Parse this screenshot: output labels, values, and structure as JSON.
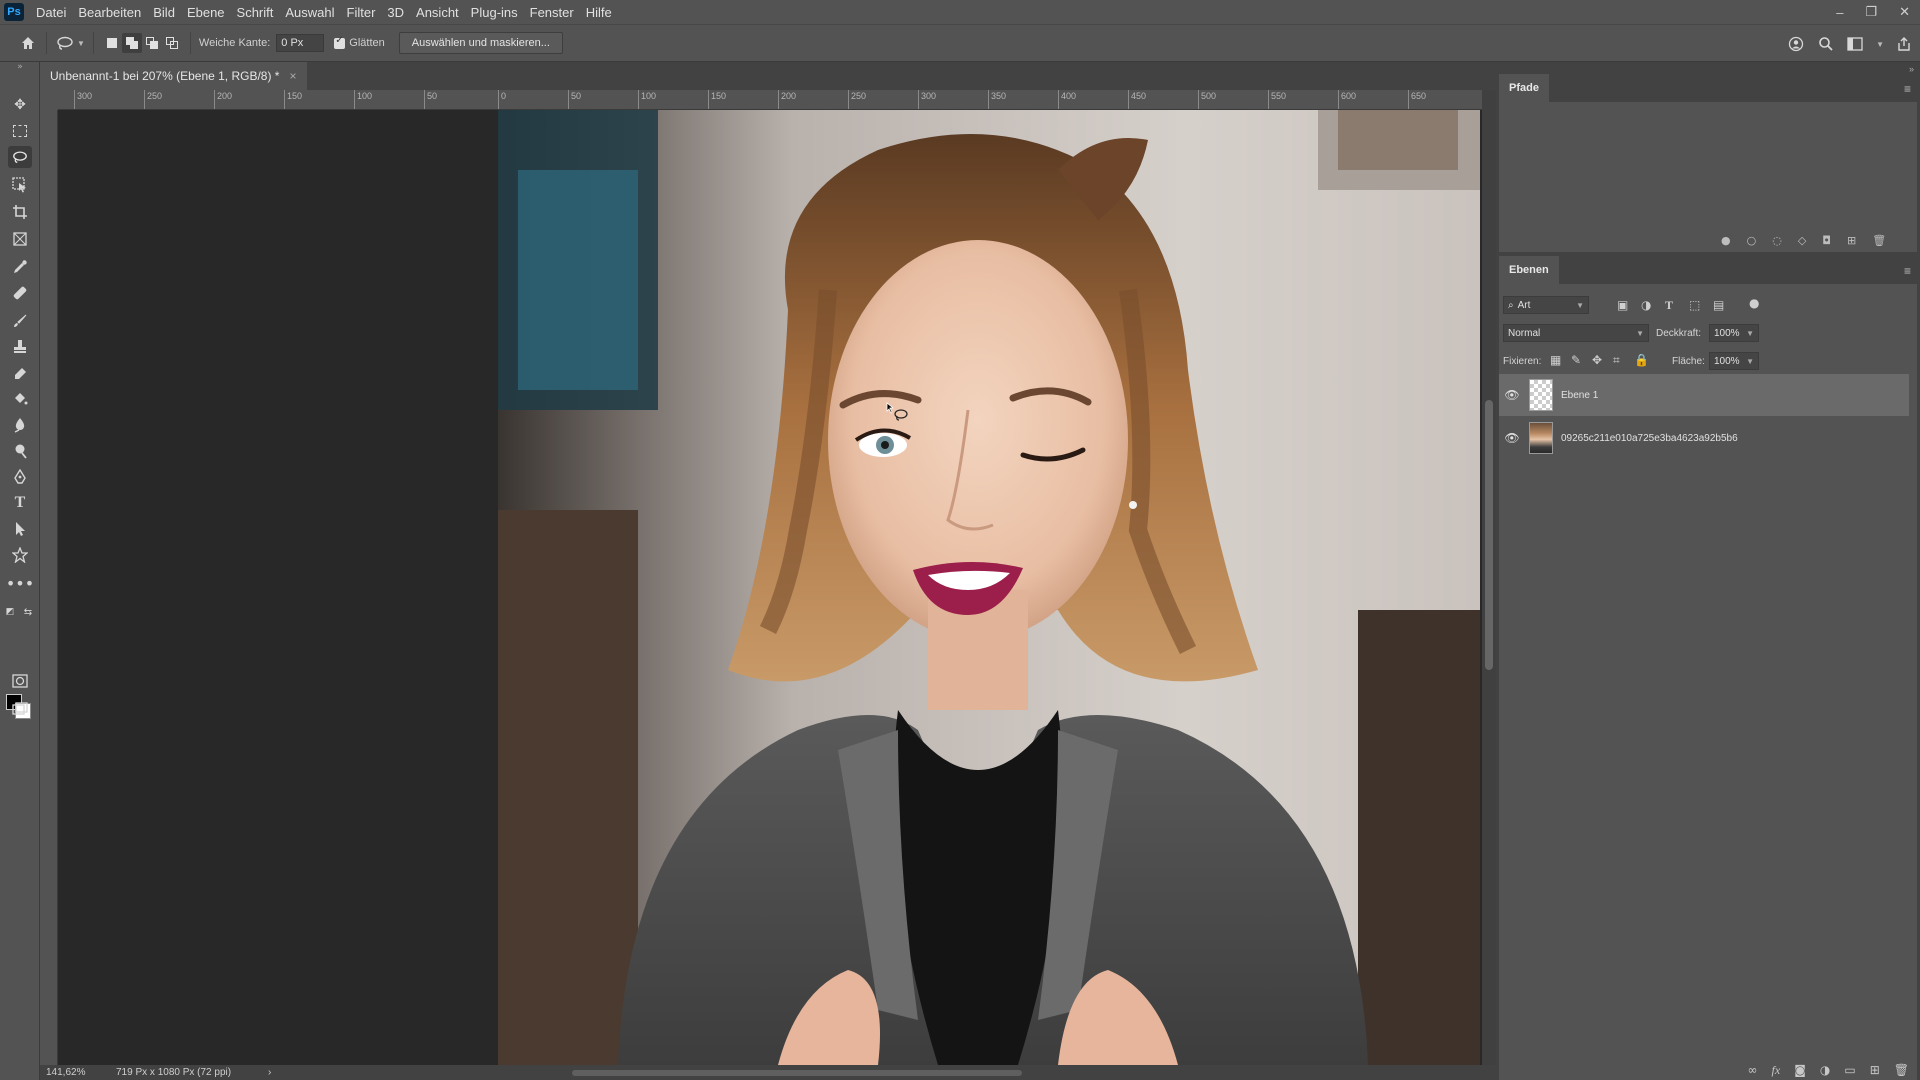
{
  "app": {
    "logo": "Ps"
  },
  "menu": [
    "Datei",
    "Bearbeiten",
    "Bild",
    "Ebene",
    "Schrift",
    "Auswahl",
    "Filter",
    "3D",
    "Ansicht",
    "Plug-ins",
    "Fenster",
    "Hilfe"
  ],
  "window_controls": {
    "minimize": "–",
    "restore": "❐",
    "close": "✕"
  },
  "options": {
    "feather_label": "Weiche Kante:",
    "feather_value": "0 Px",
    "antialias_label": "Glätten",
    "antialias_checked": true,
    "select_mask_button": "Auswählen und maskieren..."
  },
  "document": {
    "tab_title": "Unbenannt-1 bei 207% (Ebene 1, RGB/8) *",
    "tab_close": "×"
  },
  "ruler_top_labels": [
    "300",
    "250",
    "200",
    "150",
    "100",
    "50",
    "0",
    "50",
    "100",
    "150",
    "200",
    "250",
    "300",
    "350",
    "400",
    "450",
    "500",
    "550",
    "600",
    "650"
  ],
  "status": {
    "zoom": "141,62%",
    "doc_info": "719 Px x 1080 Px (72 ppi)",
    "arrow": "›"
  },
  "paths_panel": {
    "tab": "Pfade"
  },
  "layers_panel": {
    "tab": "Ebenen",
    "filter_kind": "Art",
    "blend_mode": "Normal",
    "opacity_label": "Deckkraft:",
    "opacity_value": "100%",
    "lock_label": "Fixieren:",
    "fill_label": "Fläche:",
    "fill_value": "100%",
    "layers": [
      {
        "name": "Ebene 1",
        "visible": true,
        "selected": true,
        "thumb": "transparent"
      },
      {
        "name": "09265c211e010a725e3ba4623a92b5b6",
        "visible": true,
        "selected": false,
        "thumb": "photo"
      }
    ]
  },
  "colors": {
    "ui_bg": "#535353",
    "canvas_bg": "#282828",
    "panel_dark": "#424242",
    "foreground": "#000000",
    "background": "#ffffff"
  }
}
